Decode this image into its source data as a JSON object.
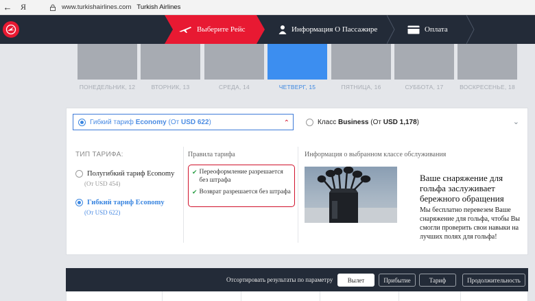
{
  "browser": {
    "back_glyph": "←",
    "ya_glyph": "Я",
    "url": "www.turkishairlines.com",
    "title": "Turkish Airlines"
  },
  "header": {
    "steps": [
      {
        "label": "Выберите Рейс",
        "icon": "plane-icon",
        "active": true
      },
      {
        "label": "Информация О Пассажире",
        "icon": "person-icon",
        "active": false
      },
      {
        "label": "Оплата",
        "icon": "card-icon",
        "active": false
      }
    ],
    "colors": {
      "bg": "#232b38",
      "accent": "#e81932"
    }
  },
  "days": [
    {
      "label": "ПОНЕДЕЛЬНИК, 12",
      "active": false
    },
    {
      "label": "ВТОРНИК, 13",
      "active": false
    },
    {
      "label": "СРЕДА, 14",
      "active": false
    },
    {
      "label": "ЧЕТВЕРГ, 15",
      "active": true
    },
    {
      "label": "ПЯТНИЦА, 16",
      "active": false
    },
    {
      "label": "СУББОТА, 17",
      "active": false
    },
    {
      "label": "ВОСКРЕСЕНЬЕ, 18",
      "active": false
    }
  ],
  "fare_tabs": {
    "economy": {
      "prefix": "Гибкий тариф",
      "name": "Economy",
      "price_prefix": "(От",
      "price": "USD 622",
      "price_suffix": ")"
    },
    "business": {
      "prefix": "Класс",
      "name": "Business",
      "price_prefix": "(От",
      "price": "USD 1,178",
      "price_suffix": ")"
    }
  },
  "fare_type": {
    "title": "ТИП ТАРИФА:",
    "options": [
      {
        "label": "Полугибкий тариф Economy",
        "price": "(От USD 454)",
        "selected": false
      },
      {
        "label": "Гибкий тариф Economy",
        "price": "(От USD 622)",
        "selected": true
      }
    ]
  },
  "rules": {
    "title": "Правила тарифа",
    "items": [
      "Переоформление разрешается без штрафа",
      "Возврат разрешается без штрафа"
    ]
  },
  "info": {
    "title": "Информация о выбранном классе обслуживания",
    "heading": "Ваше снаряжение для гольфа заслуживает бережного обращения",
    "body": "Мы бесплатно перевезем Ваше снаряжение для гольфа, чтобы Вы смогли проверить свои навыки на лучших полях для гольфа!"
  },
  "sort": {
    "label": "Отсортировать результаты по параметру",
    "buttons": [
      {
        "label": "Вылет",
        "active": true
      },
      {
        "label": "Прибытие",
        "active": false
      },
      {
        "label": "Тариф",
        "active": false
      },
      {
        "label": "Продолжительность",
        "active": false
      }
    ]
  }
}
